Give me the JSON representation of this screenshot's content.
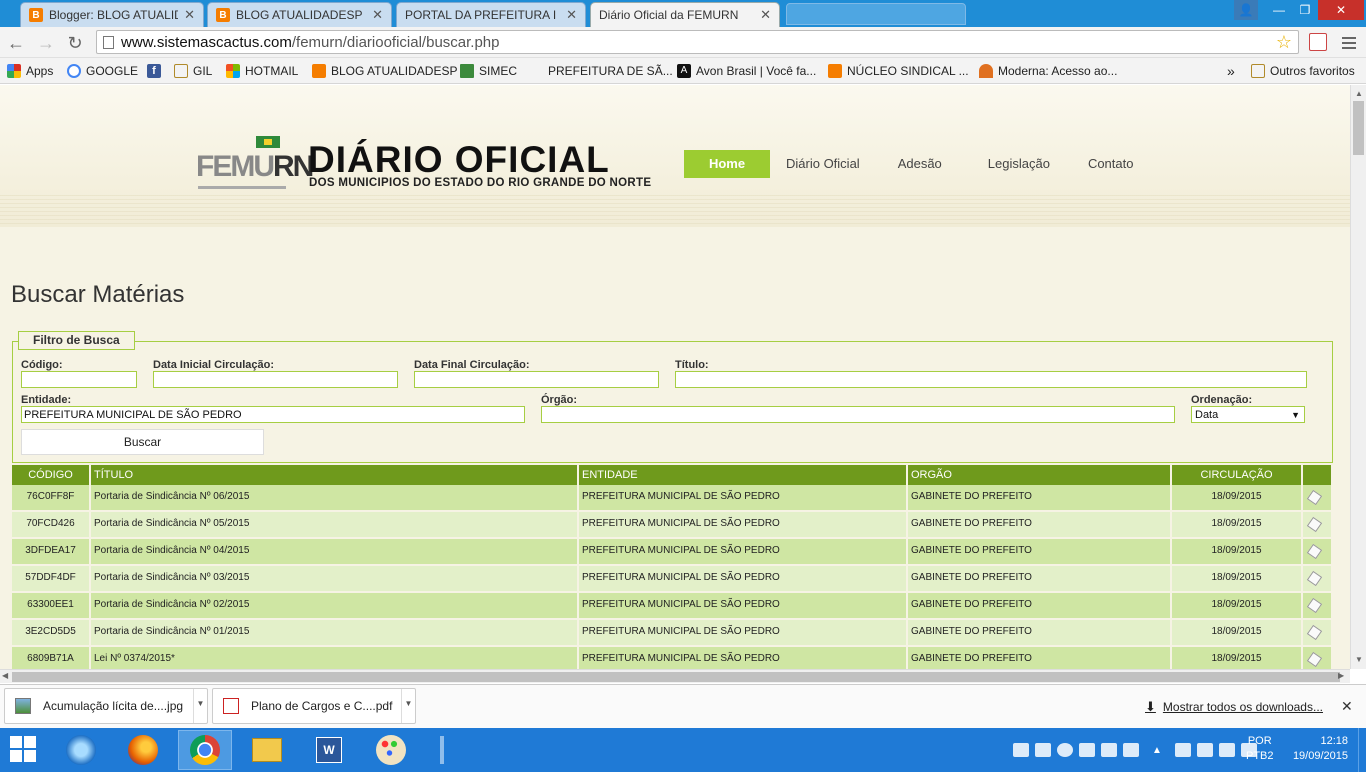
{
  "browser": {
    "tabs": [
      {
        "label": "Blogger: BLOG ATUALIDA",
        "icon": "blogger-icon",
        "active": false
      },
      {
        "label": "BLOG ATUALIDADESP",
        "icon": "blogger-icon",
        "active": false
      },
      {
        "label": "PORTAL DA PREFEITURA I",
        "icon": "page-icon",
        "active": false
      },
      {
        "label": "Diário Oficial da FEMURN",
        "icon": "page-icon",
        "active": true
      }
    ],
    "url_host": "www.sistemascactus.com",
    "url_path": "/femurn/diariooficial/buscar.php",
    "bookmarks": [
      {
        "label": "Apps",
        "icon": "apps-grid-icon",
        "color": "#d93025"
      },
      {
        "label": "GOOGLE",
        "icon": "google-icon",
        "color": "#4285f4"
      },
      {
        "label": "",
        "icon": "facebook-icon",
        "color": "#3b5998"
      },
      {
        "label": "GIL",
        "icon": "folder-icon",
        "color": "#e8c262"
      },
      {
        "label": "HOTMAIL",
        "icon": "windows-icon",
        "color": "#f25022"
      },
      {
        "label": "BLOG ATUALIDADESP",
        "icon": "blogger-icon",
        "color": "#f57d00"
      },
      {
        "label": "SIMEC",
        "icon": "simec-icon",
        "color": "#3c8a3c"
      },
      {
        "label": "PREFEITURA DE SÃ...",
        "icon": "blank-icon",
        "color": "#f3f3f3"
      },
      {
        "label": "Avon Brasil | Você fa...",
        "icon": "avon-icon",
        "color": "#111111"
      },
      {
        "label": "NÚCLEO SINDICAL ...",
        "icon": "blogger-icon",
        "color": "#f57d00"
      },
      {
        "label": "Moderna: Acesso ao...",
        "icon": "moderna-icon",
        "color": "#e07020"
      }
    ],
    "bookmarks_overflow": "»",
    "other_bookmarks": "Outros favoritos"
  },
  "site": {
    "logo_fe": "FEMU",
    "logo_rn": "RN",
    "title": "DIÁRIO OFICIAL",
    "subtitle": "DOS MUNICIPIOS DO ESTADO DO RIO GRANDE DO NORTE",
    "nav": [
      "Home",
      "Diário Oficial",
      "Adesão",
      "Legislação",
      "Contato"
    ],
    "accent": "#9ccc31",
    "table_header_color": "#6f9a1c"
  },
  "page_title": "Buscar Matérias",
  "filter": {
    "legend": "Filtro de Busca",
    "codigo_label": "Código:",
    "codigo_value": "",
    "data_inicial_label": "Data Inicial Circulação:",
    "data_inicial_value": "",
    "data_final_label": "Data Final Circulação:",
    "data_final_value": "",
    "titulo_label": "Título:",
    "titulo_value": "",
    "entidade_label": "Entidade:",
    "entidade_value": "PREFEITURA MUNICIPAL DE SÃO PEDRO",
    "orgao_label": "Órgão:",
    "orgao_value": "",
    "ordenacao_label": "Ordenação:",
    "ordenacao_value": "Data",
    "buscar_label": "Buscar"
  },
  "table": {
    "headers": [
      "CÓDIGO",
      "TÍTULO",
      "ENTIDADE",
      "ORGÃO",
      "CIRCULAÇÃO",
      ""
    ],
    "rows": [
      [
        "76C0FF8F",
        "Portaria de Sindicância Nº 06/2015",
        "PREFEITURA MUNICIPAL DE SÃO PEDRO",
        "GABINETE DO PREFEITO",
        "18/09/2015"
      ],
      [
        "70FCD426",
        "Portaria de Sindicância Nº 05/2015",
        "PREFEITURA MUNICIPAL DE SÃO PEDRO",
        "GABINETE DO PREFEITO",
        "18/09/2015"
      ],
      [
        "3DFDEA17",
        "Portaria de Sindicância Nº 04/2015",
        "PREFEITURA MUNICIPAL DE SÃO PEDRO",
        "GABINETE DO PREFEITO",
        "18/09/2015"
      ],
      [
        "57DDF4DF",
        "Portaria de Sindicância Nº 03/2015",
        "PREFEITURA MUNICIPAL DE SÃO PEDRO",
        "GABINETE DO PREFEITO",
        "18/09/2015"
      ],
      [
        "63300EE1",
        "Portaria de Sindicância Nº 02/2015",
        "PREFEITURA MUNICIPAL DE SÃO PEDRO",
        "GABINETE DO PREFEITO",
        "18/09/2015"
      ],
      [
        "3E2CD5D5",
        "Portaria de Sindicância Nº 01/2015",
        "PREFEITURA MUNICIPAL DE SÃO PEDRO",
        "GABINETE DO PREFEITO",
        "18/09/2015"
      ],
      [
        "6809B71A",
        "Lei Nº 0374/2015*",
        "PREFEITURA MUNICIPAL DE SÃO PEDRO",
        "GABINETE DO PREFEITO",
        "18/09/2015"
      ]
    ]
  },
  "downloads": {
    "items": [
      {
        "label": "Acumulação lícita de....jpg",
        "icon": "image-file-icon"
      },
      {
        "label": "Plano de Cargos e C....pdf",
        "icon": "pdf-file-icon"
      }
    ],
    "show_all": "Mostrar todos os downloads..."
  },
  "taskbar": {
    "apps": [
      "internet-explorer-icon",
      "firefox-icon",
      "chrome-icon",
      "file-explorer-icon",
      "word-icon",
      "paint-icon"
    ],
    "lang_top": "POR",
    "lang_bottom": "PTB2",
    "time": "12:18",
    "date": "19/09/2015"
  }
}
